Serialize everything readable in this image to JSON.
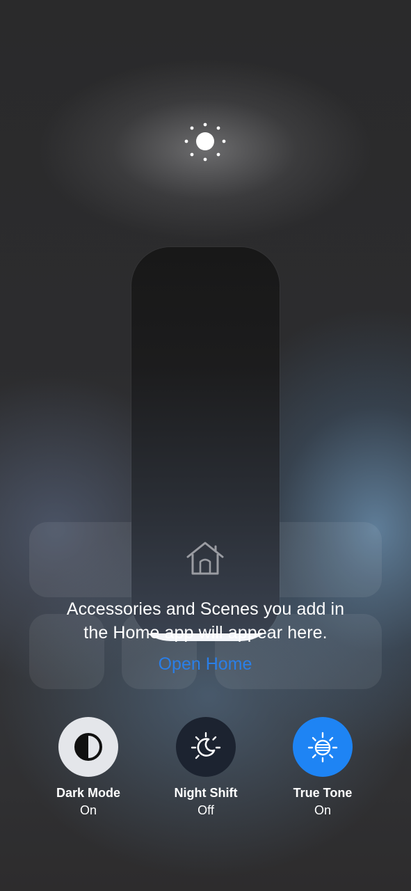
{
  "brightness": {
    "level": 0.02
  },
  "home": {
    "message_line1": "Accessories and Scenes you add in",
    "message_line2": "the Home app will appear here.",
    "open_label": "Open Home"
  },
  "toggles": [
    {
      "label": "Dark Mode",
      "state": "On",
      "icon": "dark-mode-icon",
      "color": "#e4e6ea"
    },
    {
      "label": "Night Shift",
      "state": "Off",
      "icon": "night-shift-icon",
      "color": "#1c2330"
    },
    {
      "label": "True Tone",
      "state": "On",
      "icon": "true-tone-icon",
      "color": "#1e84f4"
    }
  ],
  "colors": {
    "accent": "#2a7fe8"
  }
}
